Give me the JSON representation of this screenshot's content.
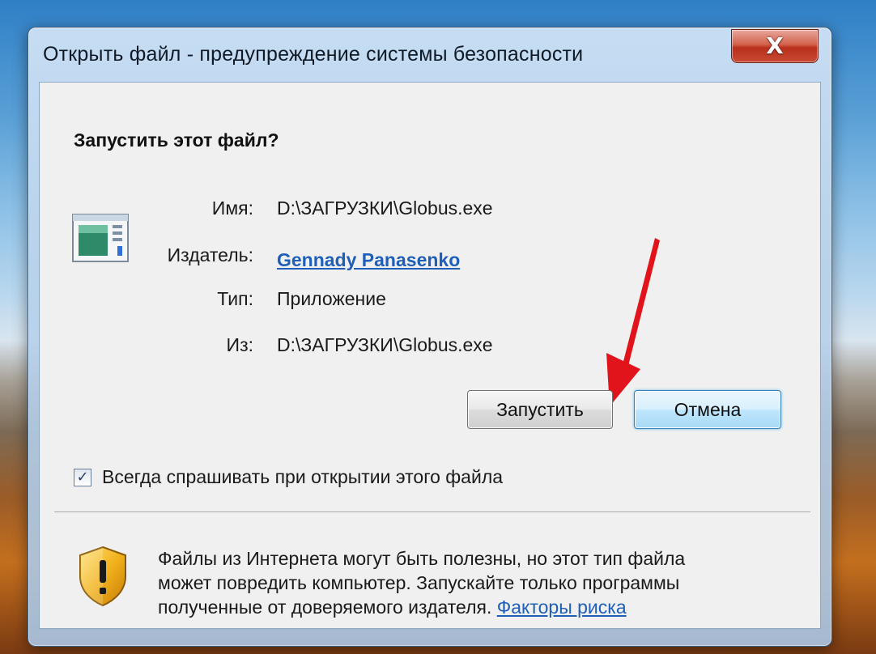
{
  "window": {
    "title": "Открыть файл - предупреждение системы безопасности",
    "close_label": "X"
  },
  "dialog": {
    "heading": "Запустить этот файл?",
    "fields": {
      "name_label": "Имя:",
      "name_value": "D:\\ЗАГРУЗКИ\\Globus.exe",
      "publisher_label": "Издатель:",
      "publisher_value": "Gennady Panasenko",
      "type_label": "Тип:",
      "type_value": "Приложение",
      "from_label": "Из:",
      "from_value": "D:\\ЗАГРУЗКИ\\Globus.exe"
    },
    "buttons": {
      "run_label": "Запустить",
      "cancel_label": "Отмена"
    },
    "checkbox": {
      "label": "Всегда спрашивать при открытии этого файла",
      "checked": true
    },
    "warning": {
      "line1": "Файлы из Интернета могут быть полезны, но этот тип файла",
      "line2": "может повредить компьютер. Запускайте только программы",
      "line3": "полученные от доверяемого издателя.",
      "risk_link": "Факторы риска"
    }
  },
  "icons": {
    "app": "application-window-icon",
    "shield": "security-shield-warning-icon",
    "arrow": "red-annotation-arrow"
  },
  "colors": {
    "link": "#1f5fb8",
    "close_button": "#c94a34",
    "arrow": "#e0141a"
  }
}
